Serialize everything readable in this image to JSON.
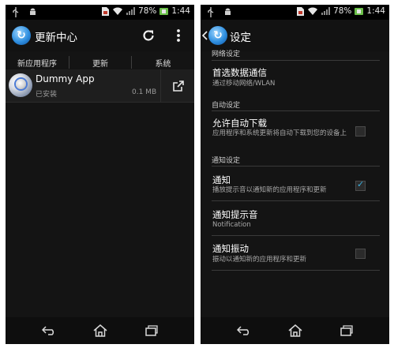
{
  "status_bar": {
    "battery_percent": "78%",
    "time": "1:44",
    "icons": [
      "usb-icon",
      "android-debug-icon",
      "sim-card-icon",
      "wifi-icon",
      "signal-icon",
      "battery-icon"
    ]
  },
  "left_screen": {
    "title": "更新中心",
    "logo_glyph": "↻",
    "refresh_icon": "refresh-icon",
    "overflow_icon": "overflow-menu-icon",
    "tabs": [
      "新应用程序",
      "更新",
      "系统"
    ],
    "app": {
      "name": "Dummy App",
      "status": "已安装",
      "size": "0.1 MB",
      "open_icon": "open-external-icon"
    }
  },
  "right_screen": {
    "title": "设定",
    "logo_glyph": "↻",
    "sections": [
      {
        "header": "网络设定"
      },
      {
        "header": "自动设定"
      },
      {
        "header": "通知设定"
      }
    ],
    "prefs": [
      {
        "title": "首选数据通信",
        "summary": "通过移动网络/WLAN"
      },
      {
        "title": "允许自动下载",
        "summary": "应用程序和系统更新将自动下载到您的设备上",
        "checked": false
      },
      {
        "title": "通知",
        "summary": "播放提示音以通知新的应用程序和更新",
        "checked": true
      },
      {
        "title": "通知提示音",
        "summary": "Notification"
      },
      {
        "title": "通知振动",
        "summary": "振动以通知新的应用程序和更新",
        "checked": false
      }
    ]
  },
  "nav_bar": {
    "icons": [
      "back-icon",
      "home-icon",
      "recent-apps-icon"
    ]
  },
  "colors": {
    "background": "#141414",
    "accent": "#3bb0e0",
    "status_bar": "#000000"
  }
}
